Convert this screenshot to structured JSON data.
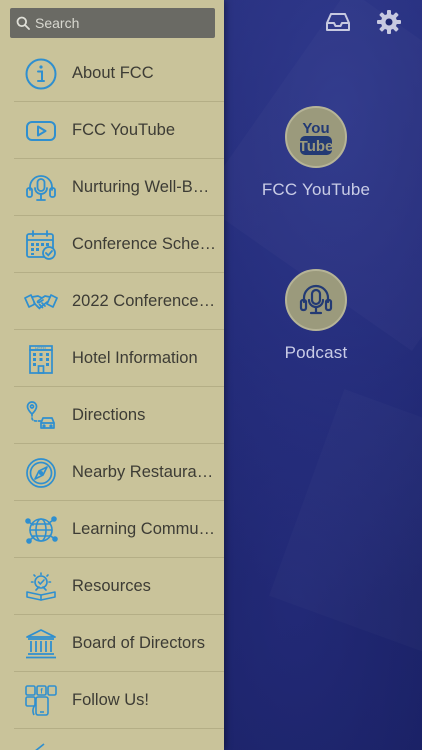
{
  "colors": {
    "drawer_bg": "#c9c39a",
    "icon_blue": "#2f8fcf",
    "app_bg": "#1c2466",
    "tile_circle": "#9b9a7c"
  },
  "header": {
    "inbox_icon": "inbox-icon",
    "settings_icon": "gear-icon"
  },
  "search": {
    "placeholder": "Search",
    "value": ""
  },
  "drawer": {
    "items": [
      {
        "label": "About FCC",
        "icon": "info-icon"
      },
      {
        "label": "FCC YouTube",
        "icon": "play-icon"
      },
      {
        "label": "Nurturing Well-B…",
        "icon": "podcast-icon"
      },
      {
        "label": "Conference Sche…",
        "icon": "calendar-icon"
      },
      {
        "label": "2022 Conference…",
        "icon": "handshake-icon"
      },
      {
        "label": "Hotel Information",
        "icon": "hotel-icon"
      },
      {
        "label": "Directions",
        "icon": "directions-icon"
      },
      {
        "label": "Nearby Restaura…",
        "icon": "compass-icon"
      },
      {
        "label": "Learning Commu…",
        "icon": "globe-network-icon"
      },
      {
        "label": "Resources",
        "icon": "resources-icon"
      },
      {
        "label": "Board of Directors",
        "icon": "institution-icon"
      },
      {
        "label": "Follow Us!",
        "icon": "social-icon"
      }
    ]
  },
  "tiles": [
    {
      "label": "FCC YouTube",
      "icon": "youtube-icon"
    },
    {
      "label": "Podcast",
      "icon": "podcast-icon"
    }
  ]
}
